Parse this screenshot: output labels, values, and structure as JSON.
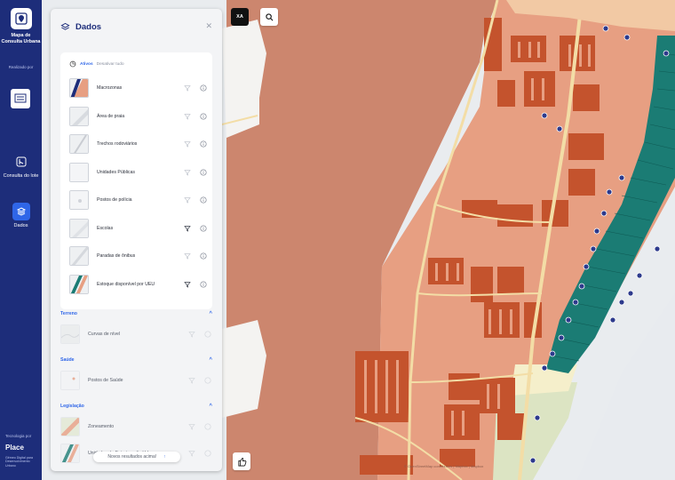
{
  "sidebar": {
    "app_title": "Mapa de Consulta Urbana",
    "realized_by": "Realizado por",
    "items": [
      {
        "label": "Consulta do lote",
        "icon": "map-pin-square-icon"
      },
      {
        "label": "Dados",
        "icon": "layers-icon"
      }
    ],
    "tech_by": "Tecnologia por",
    "brand": "Place",
    "brand_sub": "Gêmeo Digital para Desenvolvimento Urbano"
  },
  "panel": {
    "title": "Dados",
    "tabs": {
      "active": "Ativos",
      "other": "Desativar tudo"
    },
    "active_layers": [
      {
        "label": "Macrozonas",
        "style_icon": false
      },
      {
        "label": "Área de praia",
        "style_icon": false
      },
      {
        "label": "Trechos rodoviários",
        "style_icon": false
      },
      {
        "label": "Unidades Públicas",
        "style_icon": false
      },
      {
        "label": "Postos de polícia",
        "style_icon": false
      },
      {
        "label": "Escolas",
        "style_icon": true
      },
      {
        "label": "Paradas de ônibus",
        "style_icon": false
      },
      {
        "label": "Estoque disponível por UEU",
        "style_icon": true
      }
    ],
    "sections": [
      {
        "title": "Terreno",
        "items": [
          {
            "label": "Curvas de nível"
          }
        ]
      },
      {
        "title": "Saúde",
        "items": [
          {
            "label": "Postos de Saúde"
          }
        ]
      },
      {
        "title": "Legislação",
        "items": [
          {
            "label": "Zoneamento"
          },
          {
            "label": "Unidades de Estruturação Urbana"
          }
        ]
      }
    ],
    "toast": "Novos resultados acima!"
  },
  "map": {
    "language_button": "XA",
    "attribution": "© OpenStreetMap contributors | Mapbox | Mapbox"
  },
  "colors": {
    "nav_bg": "#1d2d7a",
    "accent": "#2f66e8",
    "zone_salmon": "#e79f82",
    "zone_dark_salmon": "#cc866e",
    "buildings": "#c4532d",
    "teal_blocks": "#1b7c74",
    "road": "#f3dda6"
  }
}
